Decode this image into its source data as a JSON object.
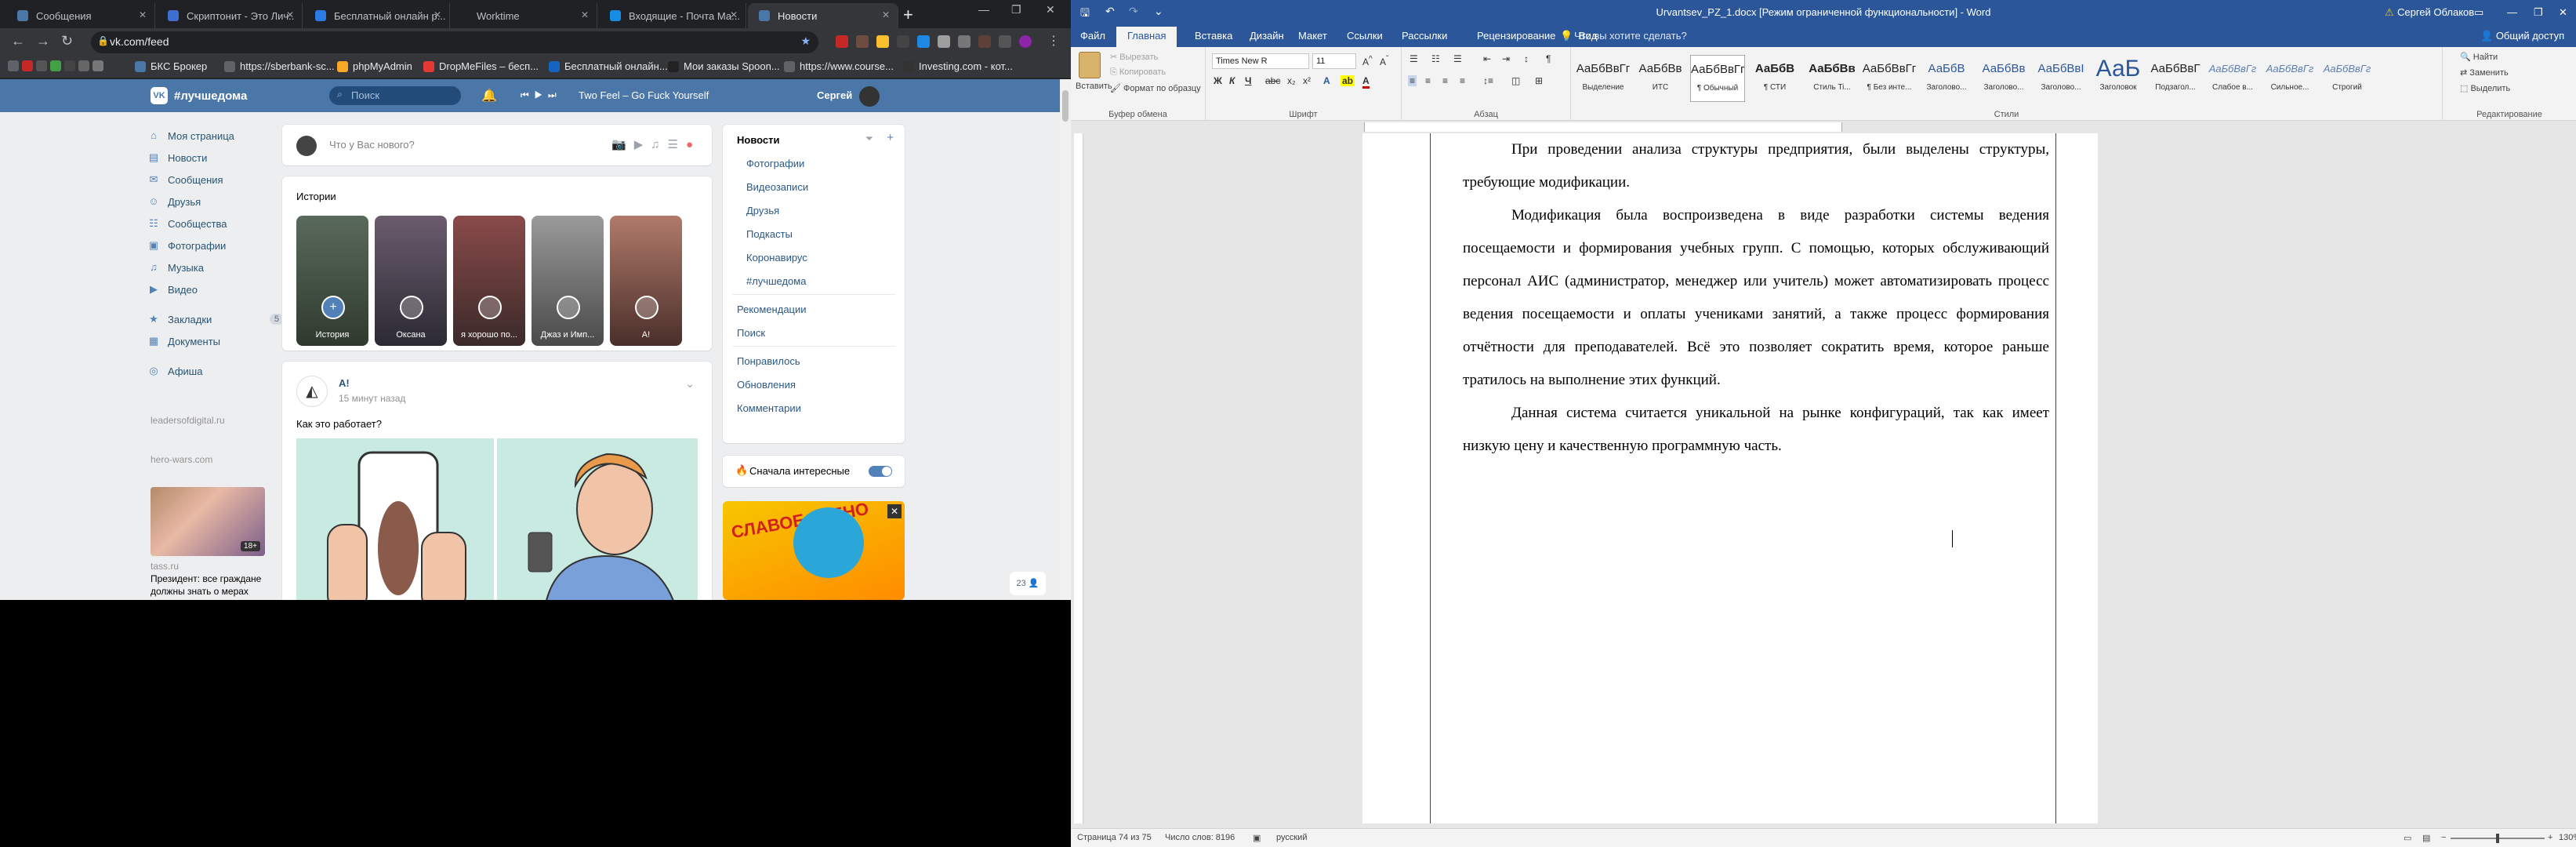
{
  "chrome": {
    "tabs": [
      {
        "title": "Сообщения",
        "fav": "#4a76a8"
      },
      {
        "title": "Скриптонит - Это Лич..",
        "fav": "#3f6fd1"
      },
      {
        "title": "Бесплатный онлайн р...",
        "fav": "#2c7be5"
      },
      {
        "title": "Worktime",
        "fav": "#555"
      },
      {
        "title": "Входящие - Почта Ма...",
        "fav": "#168de2"
      },
      {
        "title": "Новости",
        "fav": "#4a76a8"
      }
    ],
    "url": "vk.com/feed",
    "bookmarks": [
      "БКС Брокер",
      "https://sberbank-sc...",
      "phpMyAdmin",
      "DropMeFiles – бесп...",
      "Бесплатный онлайн...",
      "Мои заказы Spoon...",
      "https://www.course...",
      "Investing.com - кот..."
    ]
  },
  "vk": {
    "logo": "#лучшедома",
    "search_placeholder": "Поиск",
    "track": "Two Feel – Go Fuck Yourself",
    "user": "Сергей",
    "menu": [
      {
        "icon": "⌂",
        "label": "Моя страница"
      },
      {
        "icon": "▤",
        "label": "Новости"
      },
      {
        "icon": "✉",
        "label": "Сообщения"
      },
      {
        "icon": "☺",
        "label": "Друзья"
      },
      {
        "icon": "☷",
        "label": "Сообщества"
      },
      {
        "icon": "▣",
        "label": "Фотографии"
      },
      {
        "icon": "♫",
        "label": "Музыка"
      },
      {
        "icon": "▶",
        "label": "Видео"
      }
    ],
    "menu2": [
      {
        "icon": "★",
        "label": "Закладки",
        "badge": "5"
      },
      {
        "icon": "▦",
        "label": "Документы"
      }
    ],
    "menu3": [
      {
        "icon": "◎",
        "label": "Афиша"
      }
    ],
    "side_links": [
      "leadersofdigital.ru",
      "hero-wars.com"
    ],
    "ad_age": "18+",
    "ad_source": "tass.ru",
    "ad_text_1": "Президент: все граждане",
    "ad_text_2": "должны знать о мерах",
    "post_placeholder": "Что у Вас нового?",
    "stories_title": "Истории",
    "stories": [
      {
        "label": "История",
        "bg": "linear-gradient(#5a6a5a,#2e3a2e)"
      },
      {
        "label": "Оксана",
        "bg": "linear-gradient(#6b5c6e,#2b2a33)"
      },
      {
        "label": "я хорошо по...",
        "bg": "linear-gradient(#8a4a4a,#3b2a2a)"
      },
      {
        "label": "Джаз и Имп...",
        "bg": "linear-gradient(#9a9a9a,#4a4a4a)"
      },
      {
        "label": "A!",
        "bg": "linear-gradient(#b07a6a,#4a2f2a)"
      }
    ],
    "post": {
      "author": "A!",
      "time": "15 минут назад",
      "text": "Как это работает?"
    },
    "right_nav": {
      "main": "Новости",
      "sub": [
        "Фотографии",
        "Видеозаписи",
        "Друзья",
        "Подкасты",
        "Коронавирус",
        "#лучшедома"
      ],
      "group2": [
        "Рекомендации",
        "Поиск"
      ],
      "group3": [
        "Понравилось",
        "Обновления",
        "Комментарии"
      ]
    },
    "interest_label": "Сначала интересные",
    "banner_text": "СЛАВОЕ ЗВЕНО",
    "float_btn": "23 👤"
  },
  "word": {
    "title": "Urvantsev_PZ_1.docx [Режим ограниченной функциональности] - Word",
    "user": "Сергей Облаков",
    "share": "Общий доступ",
    "tabs": [
      "Файл",
      "Главная",
      "Вставка",
      "Дизайн",
      "Макет",
      "Ссылки",
      "Рассылки",
      "Рецензирование",
      "Вид"
    ],
    "tell_me": "Что вы хотите сделать?",
    "clipboard": {
      "paste": "Вставить",
      "cut": "Вырезать",
      "copy": "Копировать",
      "format": "Формат по образцу",
      "label": "Буфер обмена"
    },
    "font": {
      "name": "Times New R",
      "size": "11",
      "label": "Шрифт"
    },
    "paragraph_label": "Абзац",
    "styles_label": "Стили",
    "styles": [
      {
        "preview": "АаБбВвГг",
        "name": "Выделение"
      },
      {
        "preview": "АаБбВв",
        "name": "ИТС"
      },
      {
        "preview": "АаБбВвГг",
        "name": "¶ Обычный"
      },
      {
        "preview": "АаБбВ",
        "name": "¶ СТИ"
      },
      {
        "preview": "АаБбВв",
        "name": "Стиль Ti..."
      },
      {
        "preview": "АаБбВвГг",
        "name": "¶ Без инте..."
      },
      {
        "preview": "АаБбВ",
        "name": "Заголово..."
      },
      {
        "preview": "АаБбВв",
        "name": "Заголово..."
      },
      {
        "preview": "АаБбВвI",
        "name": "Заголово..."
      },
      {
        "preview": "АаБ",
        "name": "Заголовок"
      },
      {
        "preview": "АаБбВвГ",
        "name": "Подзагол..."
      },
      {
        "preview": "АаБбВвГг",
        "name": "Слабое в..."
      },
      {
        "preview": "АаБбВвГг",
        "name": "Сильное..."
      },
      {
        "preview": "АаБбВвГг",
        "name": "Строгий"
      }
    ],
    "editing": {
      "find": "Найти",
      "replace": "Заменить",
      "select": "Выделить",
      "label": "Редактирование"
    },
    "paragraphs": [
      "При проведении анализа структуры предприятия, были выделены структуры, требующие модификации.",
      "Модификация была воспроизведена в виде разработки системы ведения посещаемости и формирования учебных групп. С помощью, которых обслуживающий персонал АИС (администратор, менеджер или учитель) может автоматизировать процесс ведения посещаемости и оплаты учениками занятий, а также процесс формирования отчётности для преподавателей. Всё это позволяет сократить время, которое раньше тратилось на выполнение этих функций.",
      "Данная система считается уникальной на рынке конфигураций, так как имеет низкую цену и качественную программную часть."
    ],
    "status": {
      "page": "Страница 74 из 75",
      "words": "Число слов: 8196",
      "lang": "русский",
      "zoom": "130%"
    }
  }
}
